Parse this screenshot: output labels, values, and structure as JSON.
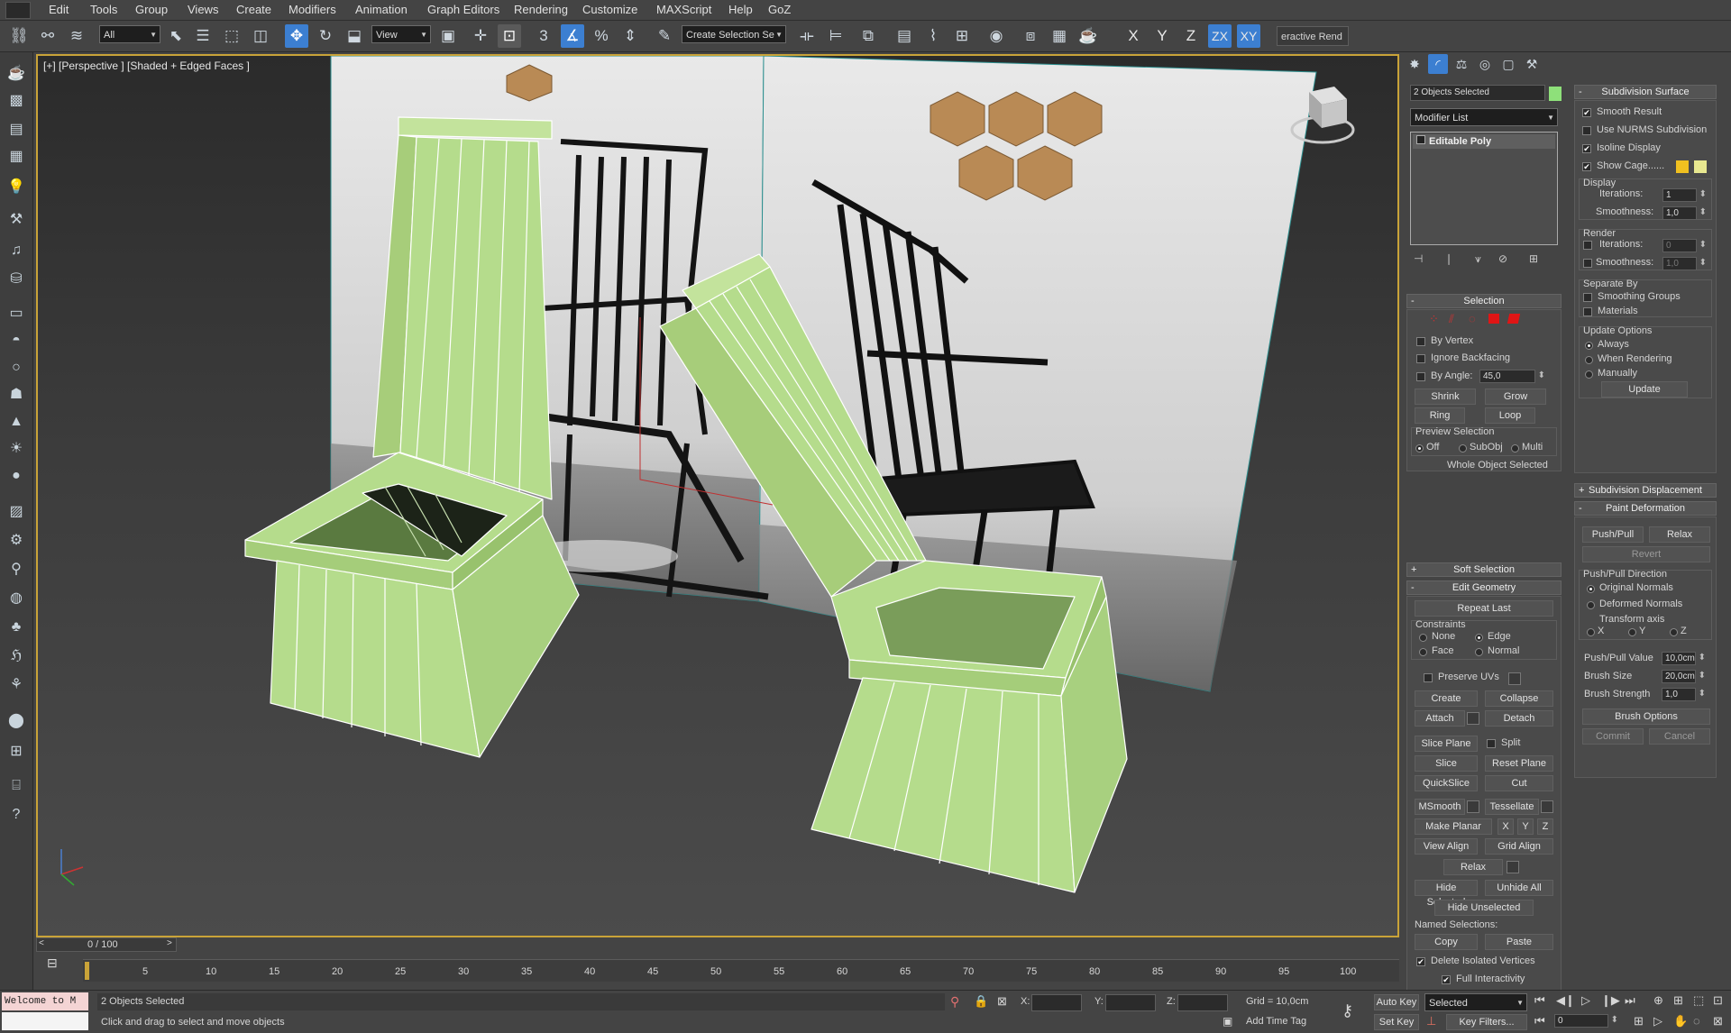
{
  "menu": [
    "Edit",
    "Tools",
    "Group",
    "Views",
    "Create",
    "Modifiers",
    "Animation",
    "Graph Editors",
    "Rendering",
    "Customize",
    "MAXScript",
    "Help",
    "GoZ"
  ],
  "toolbar": {
    "filter": "All",
    "ref_coord": "View",
    "named_selection": "Create Selection Se",
    "axes": [
      "X",
      "Y",
      "Z",
      "ZX",
      "XY"
    ],
    "interactive_render": "eractive Rend"
  },
  "viewport": {
    "label": "[+] [Perspective ] [Shaded + Edged Faces ]",
    "selection_color": "#c9a338",
    "mesh_color": "#b5dc8c"
  },
  "modify_panel": {
    "object_name": "2 Objects Selected",
    "object_color": "#8ee07a",
    "modifier_list": "Modifier List",
    "stack_item": "Editable Poly",
    "selection": {
      "title": "Selection",
      "by_vertex": "By Vertex",
      "ignore_backfacing": "Ignore Backfacing",
      "by_angle": "By Angle:",
      "angle_value": "45,0",
      "shrink": "Shrink",
      "grow": "Grow",
      "ring": "Ring",
      "loop": "Loop",
      "preview_selection": "Preview Selection",
      "preview_options": [
        "Off",
        "SubObj",
        "Multi"
      ],
      "status": "Whole Object Selected"
    },
    "soft_selection": "Soft Selection",
    "edit_geometry": {
      "title": "Edit Geometry",
      "repeat_last": "Repeat Last",
      "constraints": "Constraints",
      "constraint_options": [
        "None",
        "Edge",
        "Face",
        "Normal"
      ],
      "preserve_uvs": "Preserve UVs",
      "create": "Create",
      "collapse": "Collapse",
      "attach": "Attach",
      "detach": "Detach",
      "slice_plane": "Slice Plane",
      "split": "Split",
      "slice": "Slice",
      "reset_plane": "Reset Plane",
      "quickslice": "QuickSlice",
      "cut": "Cut",
      "msmooth": "MSmooth",
      "tessellate": "Tessellate",
      "make_planar": "Make Planar",
      "xyz": [
        "X",
        "Y",
        "Z"
      ],
      "view_align": "View Align",
      "grid_align": "Grid Align",
      "relax": "Relax",
      "hide_selected": "Hide Selected",
      "unhide_all": "Unhide All",
      "hide_unselected": "Hide Unselected",
      "named_selections": "Named Selections:",
      "copy": "Copy",
      "paste": "Paste",
      "delete_isolated": "Delete Isolated Vertices",
      "full_interactivity": "Full Interactivity"
    }
  },
  "subdivision_panel": {
    "title": "Subdivision Surface",
    "smooth_result": "Smooth Result",
    "use_nurms": "Use NURMS Subdivision",
    "isoline_display": "Isoline Display",
    "show_cage": "Show Cage......",
    "cage_colors": [
      "#f0c020",
      "#e8e890"
    ],
    "display": "Display",
    "iterations": "Iterations:",
    "display_iterations": "1",
    "smoothness": "Smoothness:",
    "display_smoothness": "1,0",
    "render": "Render",
    "render_iterations": "0",
    "render_smoothness": "1,0",
    "separate_by": "Separate By",
    "smoothing_groups": "Smoothing Groups",
    "materials": "Materials",
    "update_options": "Update Options",
    "update_modes": [
      "Always",
      "When Rendering",
      "Manually"
    ],
    "update": "Update",
    "subdivision_displacement": "Subdivision Displacement",
    "paint_deformation": "Paint Deformation",
    "push_pull": "Push/Pull",
    "relax": "Relax",
    "revert": "Revert",
    "push_pull_direction": "Push/Pull Direction",
    "directions": [
      "Original Normals",
      "Deformed Normals",
      "Transform axis"
    ],
    "axis_options": [
      "X",
      "Y",
      "Z"
    ],
    "push_pull_value": "Push/Pull Value",
    "push_pull_value_v": "10,0cm",
    "brush_size": "Brush Size",
    "brush_size_v": "20,0cm",
    "brush_strength": "Brush Strength",
    "brush_strength_v": "1,0",
    "brush_options": "Brush Options",
    "commit": "Commit",
    "cancel": "Cancel"
  },
  "timeline": {
    "frame": "0 / 100",
    "ticks": [
      "5",
      "10",
      "15",
      "20",
      "25",
      "30",
      "35",
      "40",
      "45",
      "50",
      "55",
      "60",
      "65",
      "70",
      "75",
      "80",
      "85",
      "90",
      "95",
      "100"
    ]
  },
  "status": {
    "maxscript": "Welcome to M",
    "selected": "2 Objects Selected",
    "prompt": "Click and drag to select and move objects",
    "x_label": "X:",
    "y_label": "Y:",
    "z_label": "Z:",
    "grid": "Grid = 10,0cm",
    "add_time_tag": "Add Time Tag",
    "auto_key": "Auto Key",
    "set_key": "Set Key",
    "key_mode": "Selected",
    "key_filters": "Key Filters...",
    "current_frame": "0"
  }
}
